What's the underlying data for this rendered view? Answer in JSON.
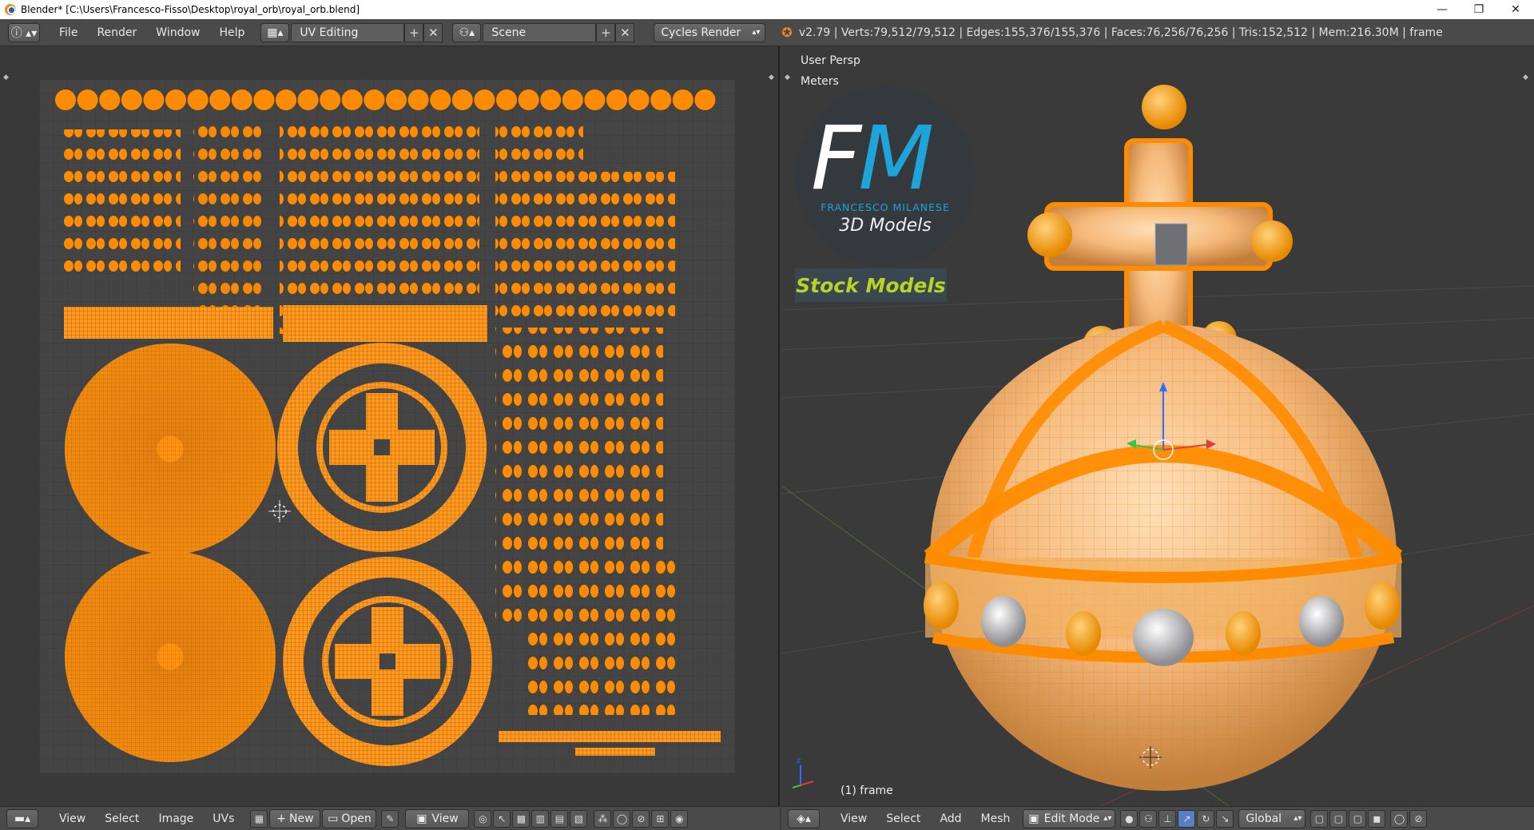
{
  "window": {
    "title": "Blender* [C:\\Users\\Francesco-Fisso\\Desktop\\royal_orb\\royal_orb.blend]",
    "controls": {
      "minimize": "—",
      "restore": "❐",
      "close": "✕"
    }
  },
  "info_header": {
    "menus": [
      "File",
      "Render",
      "Window",
      "Help"
    ],
    "screen_layout": "UV Editing",
    "scene": "Scene",
    "render_engine": "Cycles Render",
    "stats": "v2.79 | Verts:79,512/79,512 | Edges:155,376/155,376 | Faces:76,256/76,256 | Tris:152,512 | Mem:216.30M | frame"
  },
  "uv_editor": {
    "footer": {
      "menus": [
        "View",
        "Select",
        "Image",
        "UVs"
      ],
      "new_label": "New",
      "open_label": "Open",
      "view_label": "View"
    }
  },
  "viewport": {
    "view_name": "User Persp",
    "units": "Meters",
    "frame_label": "(1) frame",
    "logo": {
      "mark_f": "F",
      "mark_m": "M",
      "name": "FRANCESCO MILANESE",
      "tagline": "3D Models",
      "stock": "Stock Models"
    },
    "footer": {
      "menus": [
        "View",
        "Select",
        "Add",
        "Mesh"
      ],
      "mode": "Edit Mode",
      "orientation": "Global"
    }
  },
  "colors": {
    "uv_orange": "#ff8c00",
    "logo_blue": "#1ea4d8",
    "stock_green": "#b8d324",
    "background": "#393939"
  }
}
